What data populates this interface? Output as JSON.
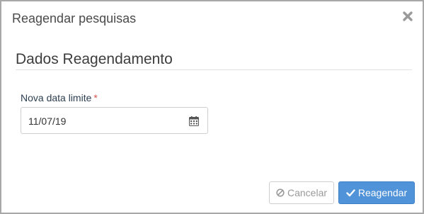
{
  "modal": {
    "title": "Reagendar pesquisas",
    "close_icon": "close-icon"
  },
  "section": {
    "title": "Dados Reagendamento"
  },
  "field": {
    "label": "Nova data limite",
    "required_marker": "*",
    "value": "11/07/19",
    "icon": "calendar-icon"
  },
  "footer": {
    "cancel_label": "Cancelar",
    "cancel_icon": "ban-icon",
    "submit_label": "Reagendar",
    "submit_icon": "check-icon"
  },
  "colors": {
    "primary": "#5093d8",
    "required": "#d9534f",
    "border": "#a8a8a8"
  }
}
